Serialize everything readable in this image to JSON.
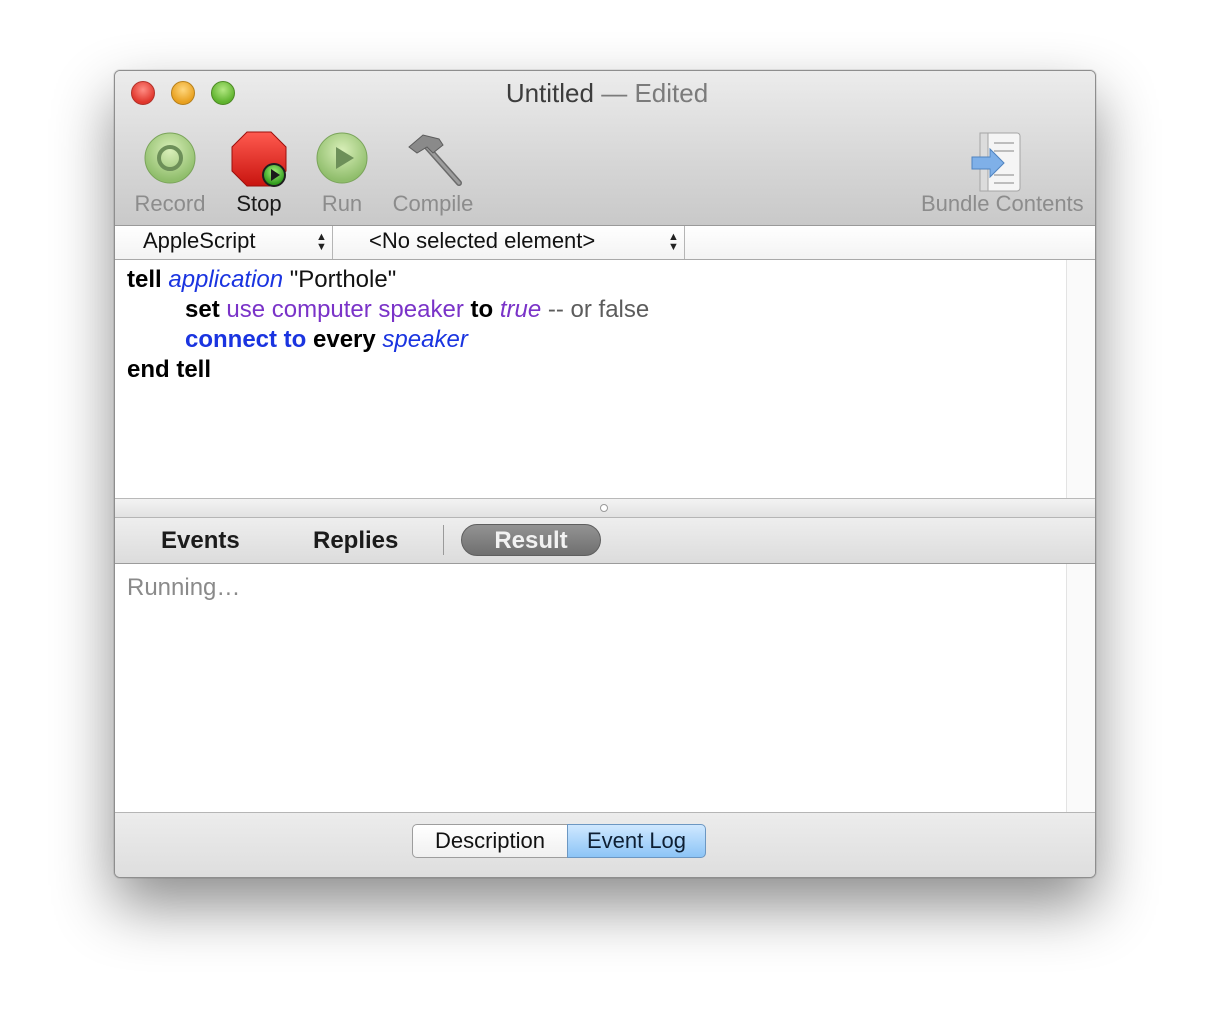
{
  "window": {
    "title": "Untitled",
    "title_separator": "—",
    "title_status": "Edited"
  },
  "toolbar": {
    "record_label": "Record",
    "stop_label": "Stop",
    "run_label": "Run",
    "compile_label": "Compile",
    "bundle_label": "Bundle Contents"
  },
  "navigation_bar": {
    "language": "AppleScript",
    "element": "<No selected element>"
  },
  "script": {
    "line1": {
      "kw": "tell",
      "cls": "application",
      "str": "\"Porthole\""
    },
    "line2": {
      "kw": "set",
      "prop": "use computer speaker",
      "kw2": "to",
      "val": "true",
      "comment": "-- or false"
    },
    "line3": {
      "cmd": "connect to",
      "kw": "every",
      "cls": "speaker"
    },
    "line4": {
      "kw": "end tell"
    }
  },
  "log_tabs": {
    "events": "Events",
    "replies": "Replies",
    "result": "Result",
    "selected": "Result"
  },
  "output": {
    "text": "Running…"
  },
  "bottom_tabs": {
    "description": "Description",
    "event_log": "Event Log",
    "selected": "Event Log"
  },
  "icons": [
    "record-icon",
    "stop-icon",
    "run-icon",
    "compile-hammer-icon",
    "bundle-contents-icon"
  ],
  "colors": {
    "keyword_blue": "#1a34e0",
    "property_purple": "#7a33c8",
    "selected_tab_blue": "#8cc4f6",
    "stop_red": "#e3201c"
  }
}
